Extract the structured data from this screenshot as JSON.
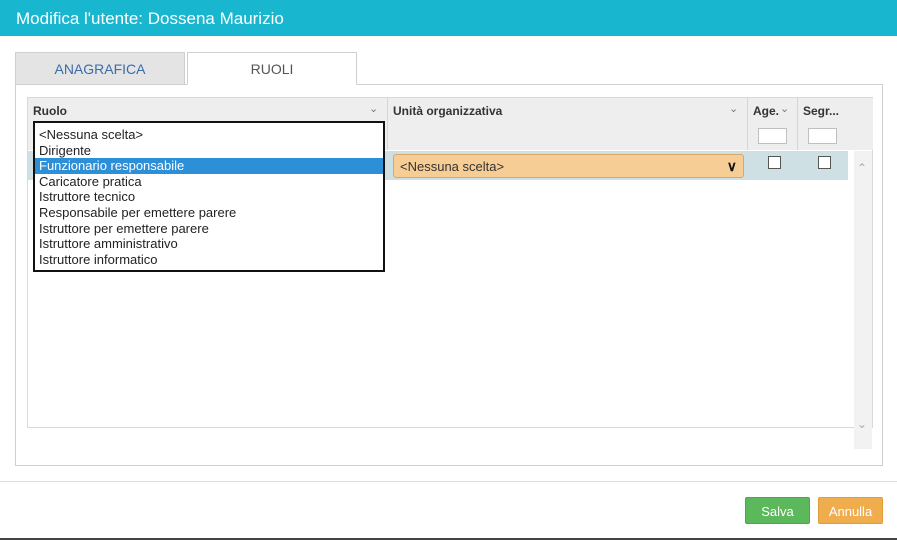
{
  "header": {
    "title": "Modifica l'utente: Dossena Maurizio"
  },
  "tabs": [
    {
      "label": "ANAGRAFICA",
      "active": false
    },
    {
      "label": "RUOLI",
      "active": true
    }
  ],
  "grid": {
    "columns": [
      {
        "label": "Ruolo",
        "icon": "chevron-down-icon"
      },
      {
        "label": "Unità organizzativa",
        "icon": "chevron-down-icon"
      },
      {
        "label": "Age.",
        "icon": "chevron-down-icon"
      },
      {
        "label": "Segr...",
        "icon": "chevron-down-icon"
      }
    ],
    "row": {
      "org_value": "<Nessuna scelta>",
      "age_checked": false,
      "segr_checked": false
    }
  },
  "ruolo_dropdown": {
    "options": [
      "<Nessuna scelta>",
      "Dirigente",
      "Funzionario responsabile",
      "Caricatore pratica",
      "Istruttore tecnico",
      "Responsabile per emettere parere",
      "Istruttore per emettere parere",
      "Istruttore amministrativo",
      "Istruttore informatico"
    ],
    "selected_index": 2,
    "selected_color": "#2d8fd7"
  },
  "footer": {
    "save_label": "Salva",
    "cancel_label": "Annulla"
  },
  "colors": {
    "header": "#18b6cf",
    "save": "#5bb85b",
    "cancel": "#f0ad4e",
    "row_highlight": "#cfe0e4",
    "org_select": "#f6ce95"
  }
}
